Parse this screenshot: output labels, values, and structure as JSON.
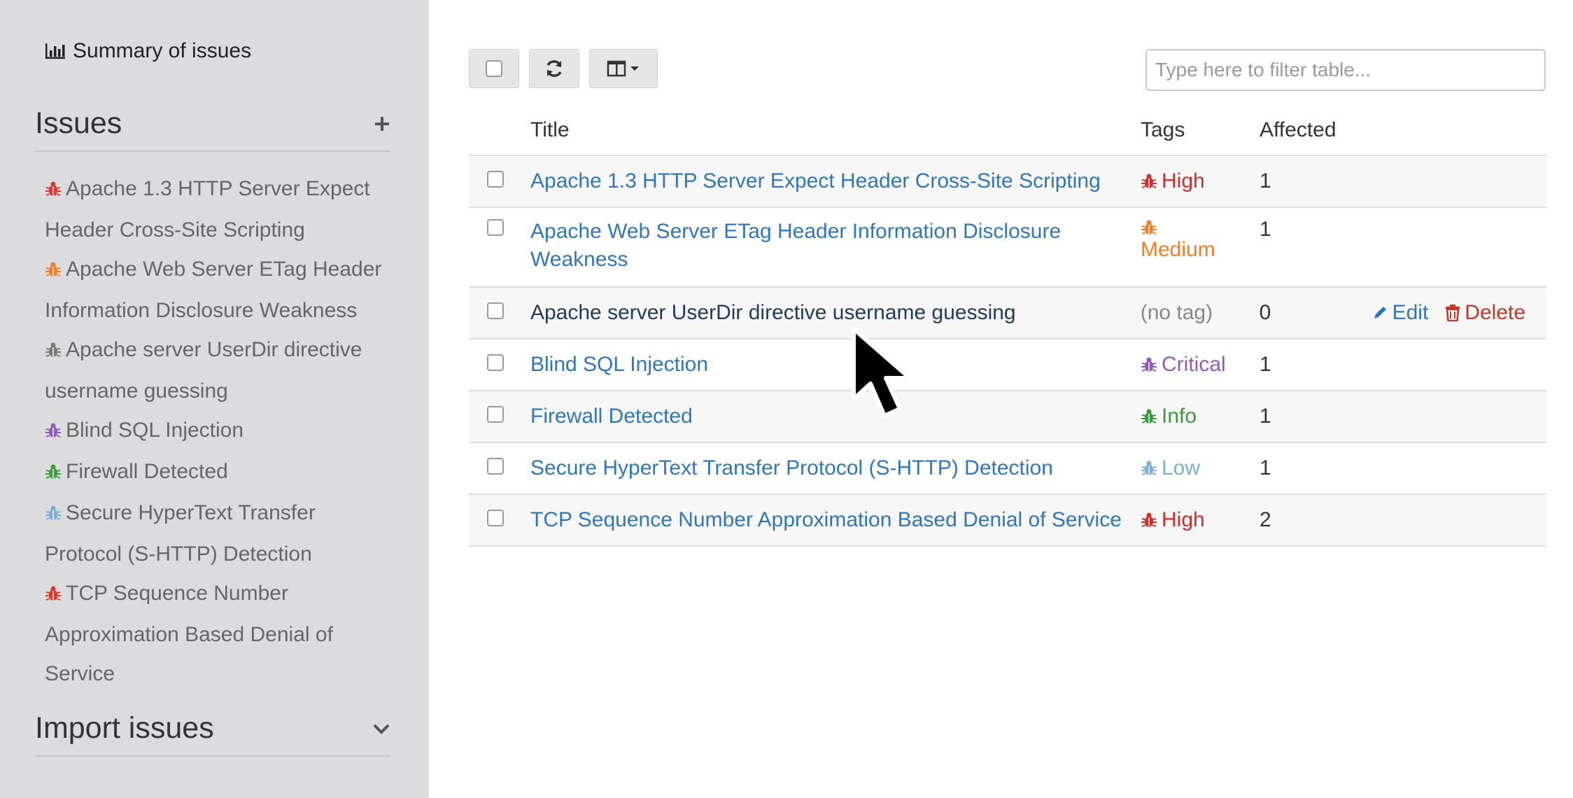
{
  "sidebar": {
    "summary_label": "Summary of issues",
    "issues_heading": "Issues",
    "import_heading": "Import issues",
    "items": [
      {
        "label": "Apache 1.3 HTTP Server Expect Header Cross-Site Scripting",
        "color": "#d9382f"
      },
      {
        "label": "Apache Web Server ETag Header Information Disclosure Weakness",
        "color": "#f08028"
      },
      {
        "label": "Apache server UserDir directive username guessing",
        "color": "#7a7a7a"
      },
      {
        "label": "Blind SQL Injection",
        "color": "#8e5bb5"
      },
      {
        "label": "Firewall Detected",
        "color": "#3c9a3c"
      },
      {
        "label": "Secure HyperText Transfer Protocol (S-HTTP) Detection",
        "color": "#7aaed6"
      },
      {
        "label": "TCP Sequence Number Approximation Based Denial of Service",
        "color": "#d9382f"
      }
    ]
  },
  "toolbar": {
    "select_all_icon": "checkbox-icon",
    "refresh_icon": "refresh-icon",
    "columns_icon": "columns-icon"
  },
  "filter": {
    "placeholder": "Type here to filter table..."
  },
  "table": {
    "headers": {
      "title": "Title",
      "tags": "Tags",
      "affected": "Affected"
    },
    "rows": [
      {
        "title": "Apache 1.3 HTTP Server Expect Header Cross-Site Scripting",
        "tag": "High",
        "tag_color": "#c9302c",
        "affected": "1"
      },
      {
        "title": "Apache Web Server ETag Header Information Disclosure Weakness",
        "tag": "Medium",
        "tag_color": "#f08028",
        "affected": "1"
      },
      {
        "title": "Apache server UserDir directive username guessing",
        "tag": "(no tag)",
        "tag_color": "#888888",
        "affected": "0",
        "edit_label": "Edit",
        "delete_label": "Delete"
      },
      {
        "title": "Blind SQL Injection",
        "tag": "Critical",
        "tag_color": "#8e5bb5",
        "affected": "1"
      },
      {
        "title": "Firewall Detected",
        "tag": "Info",
        "tag_color": "#3c9a3c",
        "affected": "1"
      },
      {
        "title": "Secure HyperText Transfer Protocol (S-HTTP) Detection",
        "tag": "Low",
        "tag_color": "#7aaed6",
        "affected": "1"
      },
      {
        "title": "TCP Sequence Number Approximation Based Denial of Service",
        "tag": "High",
        "tag_color": "#c9302c",
        "affected": "2"
      }
    ]
  }
}
